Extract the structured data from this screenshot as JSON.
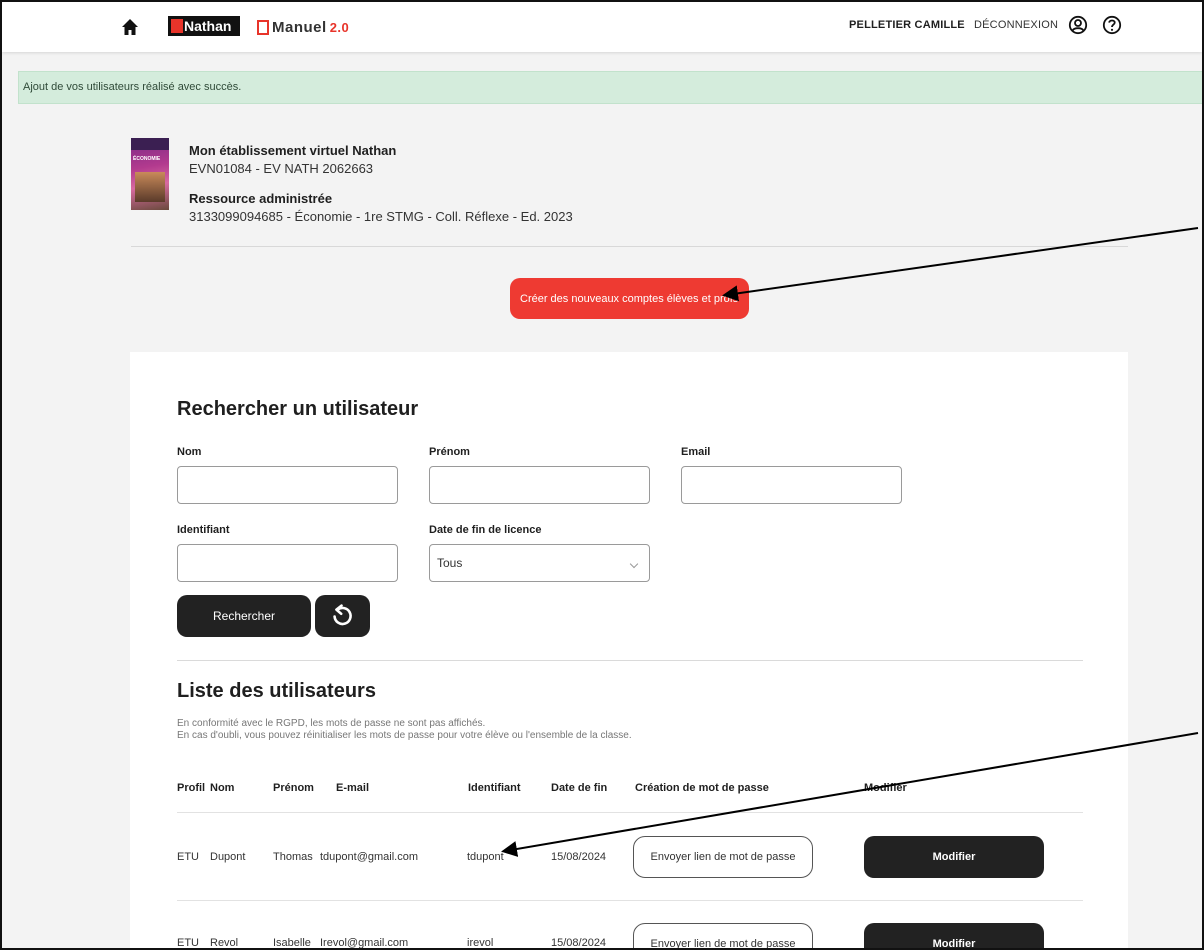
{
  "header": {
    "brand_nathan": "Nathan",
    "brand_emanuel": "Manuel",
    "brand_emanuel_version": "2.0",
    "user_name": "PELLETIER CAMILLE",
    "logout_label": "DÉCONNEXION"
  },
  "banner": {
    "message": "Ajout de vos utilisateurs réalisé avec succès."
  },
  "establishment": {
    "cover_text": "ÉCONOMIE",
    "name": "Mon établissement virtuel Nathan",
    "code": "EVN01084 - EV NATH 2062663",
    "resource_title": "Ressource administrée",
    "resource_code": "3133099094685 - Économie - 1re STMG - Coll. Réflexe - Ed. 2023"
  },
  "create_button": {
    "label": "Créer des nouveaux comptes élèves et profs"
  },
  "search": {
    "title": "Rechercher un utilisateur",
    "nom_label": "Nom",
    "prenom_label": "Prénom",
    "email_label": "Email",
    "identifiant_label": "Identifiant",
    "date_label": "Date de fin de licence",
    "date_selected": "Tous",
    "submit_label": "Rechercher"
  },
  "list": {
    "title": "Liste des utilisateurs",
    "rgpd_line1": "En conformité avec le RGPD, les mots de passe ne sont pas affichés.",
    "rgpd_line2": "En cas d'oubli, vous pouvez réinitialiser les mots de passe pour votre élève ou l'ensemble de la classe.",
    "columns": {
      "profil": "Profil",
      "nom": "Nom",
      "prenom": "Prénom",
      "email": "E-mail",
      "identifiant": "Identifiant",
      "date_fin": "Date de fin",
      "creation": "Création de mot de passe",
      "modifier": "Modifier"
    },
    "rows": [
      {
        "profil": "ETU",
        "nom": "Dupont",
        "prenom": "Thomas",
        "email": "tdupont@gmail.com",
        "identifiant": "tdupont",
        "date_fin": "15/08/2024",
        "pw_label": "Envoyer lien de mot de passe",
        "modify_label": "Modifier"
      },
      {
        "profil": "ETU",
        "nom": "Revol",
        "prenom": "Isabelle",
        "email": "Irevol@gmail.com",
        "identifiant": "irevol",
        "date_fin": "15/08/2024",
        "pw_label": "Envoyer lien de mot de passe",
        "modify_label": "Modifier"
      }
    ]
  },
  "colors": {
    "accent_red": "#ee3a32",
    "dark_button": "#222222",
    "success_bg": "#d4ecdc",
    "page_bg": "#f3f3f3"
  },
  "icons": [
    "home-icon",
    "account-icon",
    "help-icon",
    "reset-icon",
    "chevron-down-icon"
  ]
}
